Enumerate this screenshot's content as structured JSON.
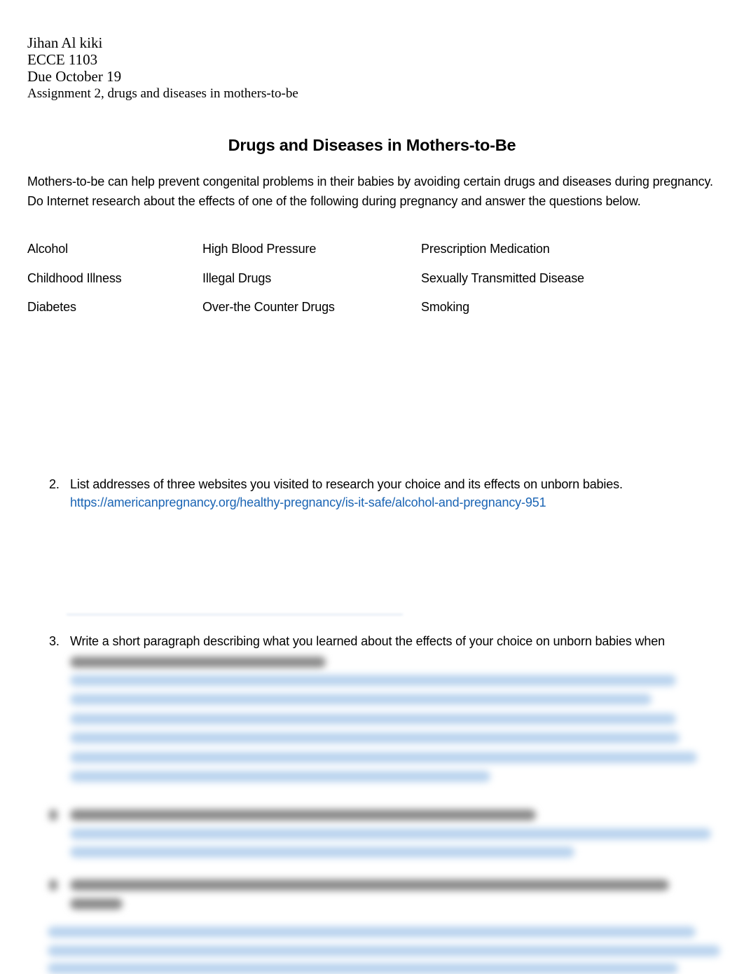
{
  "header": {
    "name": "Jihan Al kiki",
    "course": "ECCE 1103",
    "due": "Due October 19",
    "assignment": "Assignment 2, drugs and diseases in mothers-to-be"
  },
  "title": "Drugs and Diseases in Mothers-to-Be",
  "intro": "Mothers-to-be can help prevent congenital problems in their babies by avoiding certain drugs and diseases during pregnancy.  Do Internet research about the effects of one of the following during pregnancy and answer the questions below.",
  "options": [
    [
      "Alcohol",
      "High Blood Pressure",
      "Prescription Medication"
    ],
    [
      "Childhood Illness",
      "Illegal Drugs",
      "Sexually Transmitted Disease"
    ],
    [
      "Diabetes",
      "Over-the Counter Drugs",
      "Smoking"
    ]
  ],
  "questions": [
    {
      "number": "2.",
      "text": "List addresses of three websites you visited to research your choice and its effects on unborn babies.",
      "answer_link": "https://americanpregnancy.org/healthy-pregnancy/is-it-safe/alcohol-and-pregnancy-951"
    },
    {
      "number": "3.",
      "text": "Write a short paragraph describing what you learned about the effects of your choice on unborn babies when"
    }
  ],
  "colors": {
    "link": "#1a64b4",
    "blurred_answer": "#b9d3ee"
  }
}
